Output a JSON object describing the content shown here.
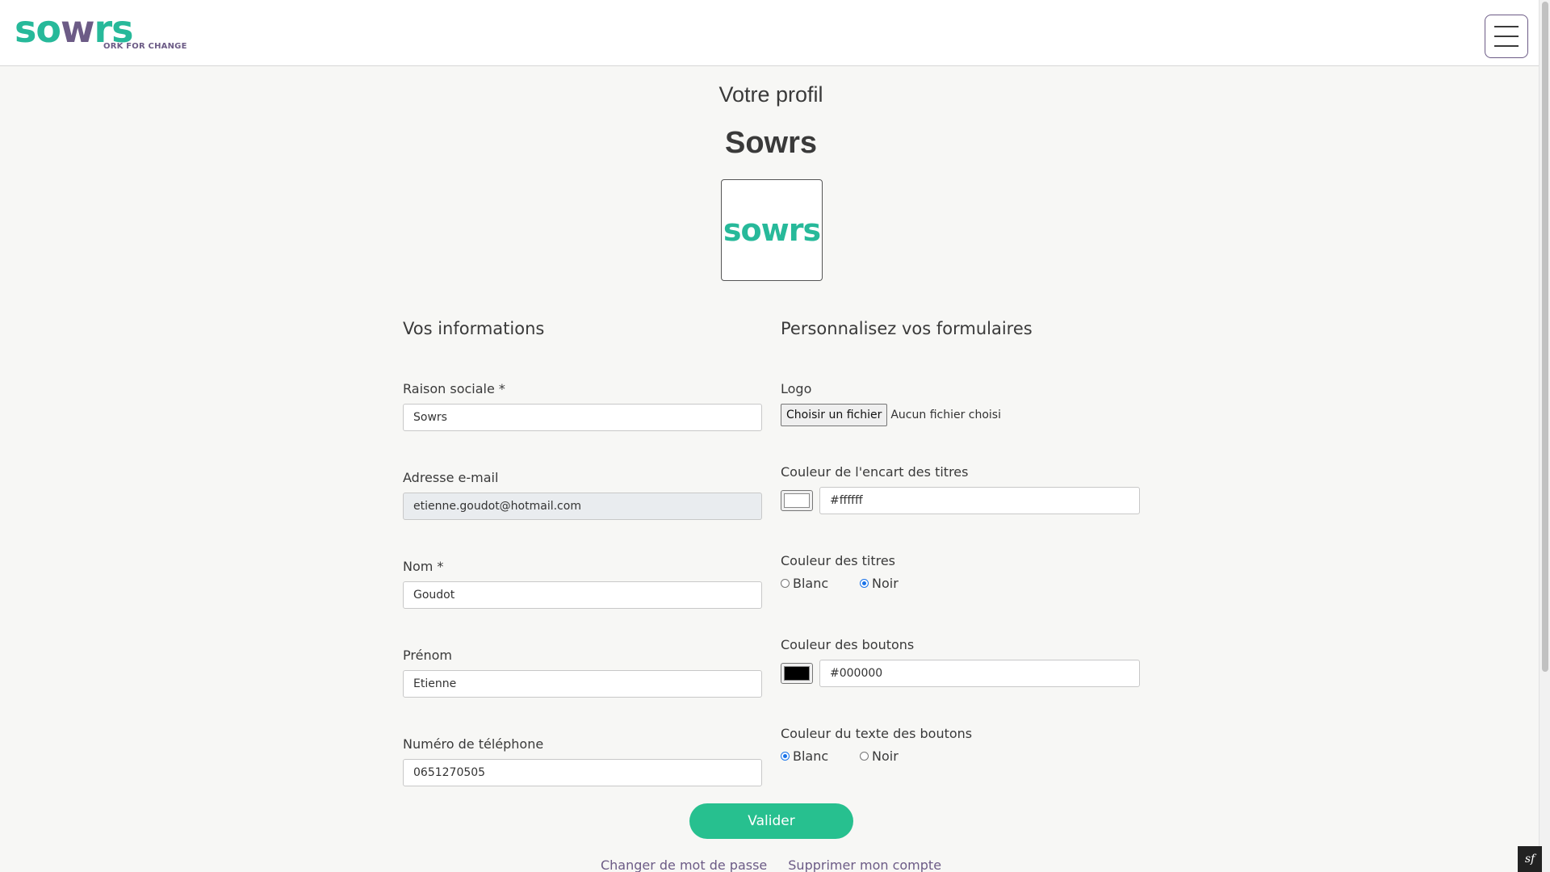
{
  "header": {
    "brand_part1": "so",
    "brand_part2": "w",
    "brand_part3": "rs",
    "brand_tagline": "ORK FOR CHANGE",
    "brand_color_primary": "#27b99a",
    "brand_color_secondary": "#6c5b86",
    "menu_icon": "hamburger-icon"
  },
  "profile": {
    "page_title": "Votre profil",
    "company_name": "Sowrs",
    "logo_text": "sowrs"
  },
  "info_section": {
    "title": "Vos informations",
    "fields": {
      "raison_sociale": {
        "label": "Raison sociale *",
        "value": "Sowrs"
      },
      "email": {
        "label": "Adresse e-mail",
        "value": "etienne.goudot@hotmail.com"
      },
      "nom": {
        "label": "Nom *",
        "value": "Goudot"
      },
      "prenom": {
        "label": "Prénom",
        "value": "Etienne"
      },
      "telephone": {
        "label": "Numéro de téléphone",
        "value": "0651270505"
      }
    }
  },
  "custom_section": {
    "title": "Personnalisez vos formulaires",
    "logo": {
      "label": "Logo",
      "button": "Choisir un fichier",
      "status": "Aucun fichier choisi"
    },
    "header_color": {
      "label": "Couleur de l'encart des titres",
      "value": "#ffffff"
    },
    "title_color": {
      "label": "Couleur des titres",
      "option_white": "Blanc",
      "option_black": "Noir",
      "selected": "Noir"
    },
    "button_color": {
      "label": "Couleur des boutons",
      "value": "#000000"
    },
    "button_text_color": {
      "label": "Couleur du texte des boutons",
      "option_white": "Blanc",
      "option_black": "Noir",
      "selected": "Blanc"
    }
  },
  "actions": {
    "submit": "Valider",
    "submit_color": "#27c08f",
    "change_password": "Changer de mot de passe",
    "delete_account": "Supprimer mon compte"
  },
  "debug_badge": "sf"
}
